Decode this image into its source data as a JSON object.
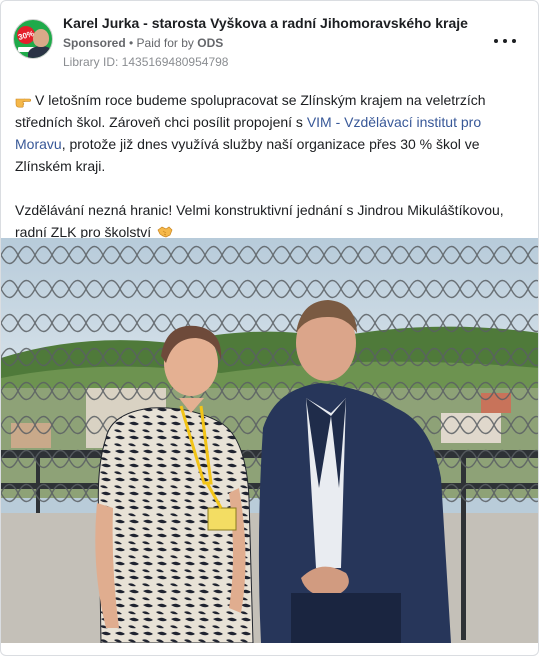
{
  "post": {
    "page_name": "Karel Jurka - starosta Vyškova a radní Jihomoravského kraje",
    "sponsored_label": "Sponsored",
    "separator": " • ",
    "paid_for_prefix": "Paid for by ",
    "paid_for_by": "ODS",
    "library_id": "Library ID: 1435169480954798",
    "avatar_badge": "30%",
    "menu_icon": "more-options-icon"
  },
  "message": {
    "p1_emoji": "pointing-hand-emoji",
    "p1_text_before_link": "V letošním roce budeme spolupracovat se Zlínským krajem na veletrzích středních škol. Zároveň chci posílit propojení s ",
    "p1_link": "VIM - Vzdělávací institut pro Moravu",
    "p1_text_after_link": ", protože již dnes využívá služby naší organizace přes 30 % škol ve Zlínském kraji.",
    "p2_text": "Vzdělávání nezná hranic! Velmi konstruktivní jednání s Jindrou Mikuláštíkovou, radní ZLK pro školství",
    "p2_emoji": "handshake-emoji"
  },
  "colors": {
    "link": "#385898",
    "avatar_green": "#1faa4a",
    "badge_red": "#e41e2b",
    "lanyard_yellow": "#f2c417"
  }
}
